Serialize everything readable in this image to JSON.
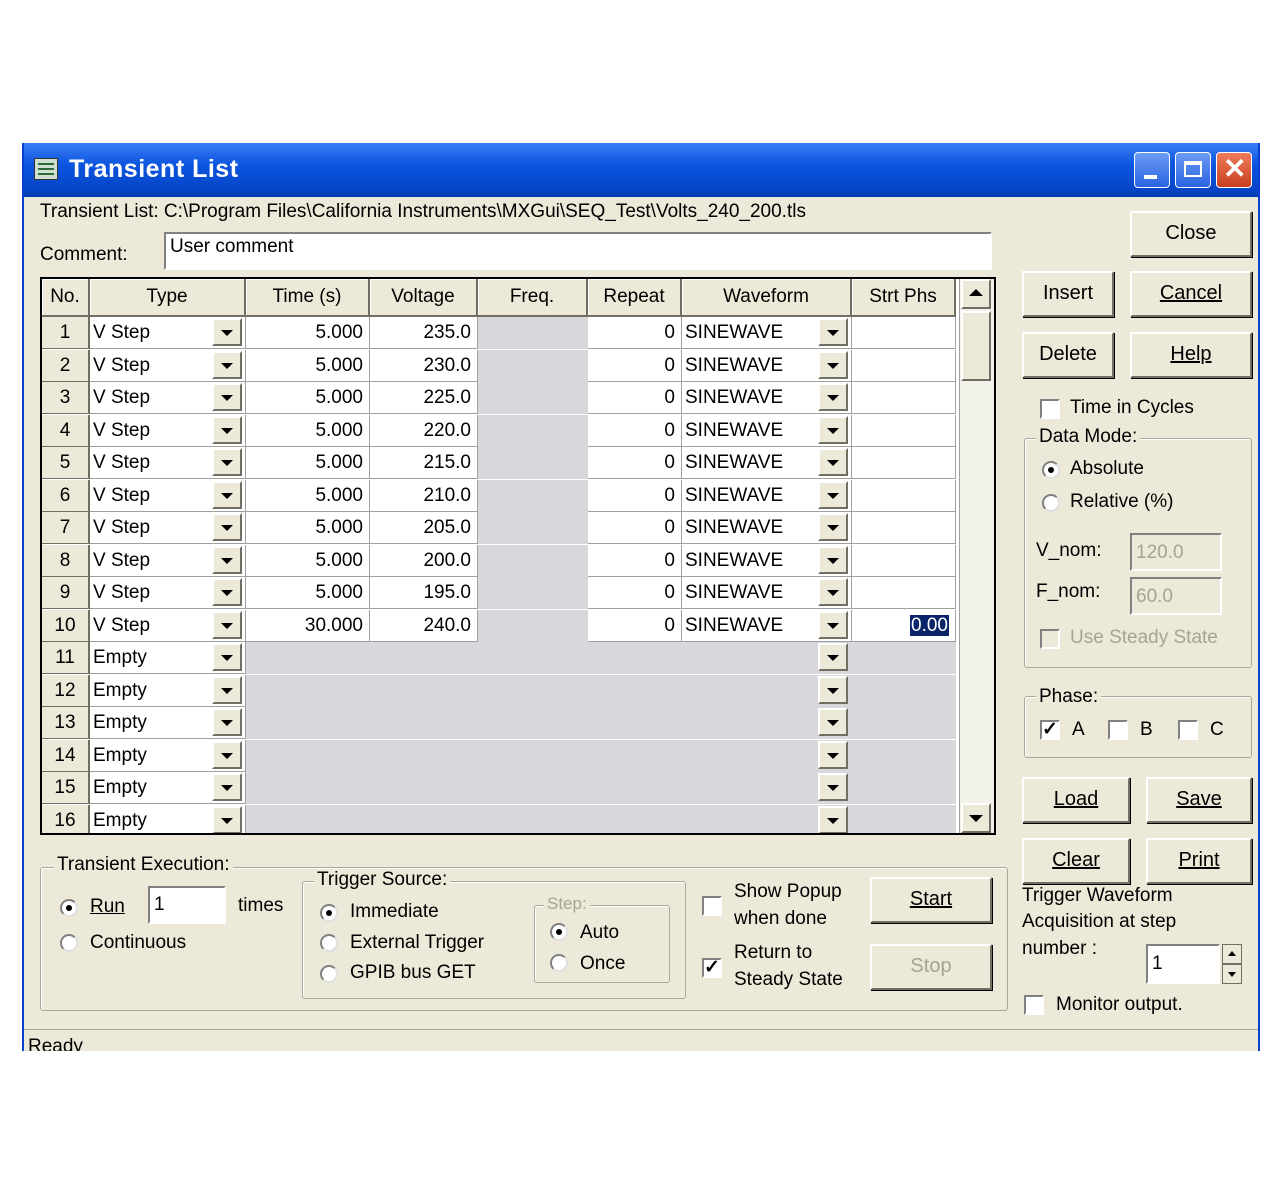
{
  "window": {
    "title": "Transient List"
  },
  "file": {
    "label": "Transient List:",
    "path": "C:\\Program Files\\California Instruments\\MXGui\\SEQ_Test\\Volts_240_200.tls"
  },
  "comment": {
    "label": "Comment:",
    "value": "User comment"
  },
  "grid": {
    "headers": [
      "No.",
      "Type",
      "Time (s)",
      "Voltage",
      "Freq.",
      "Repeat",
      "Waveform",
      "Strt Phs"
    ],
    "rows": [
      {
        "no": "1",
        "type": "V Step",
        "time": "5.000",
        "voltage": "235.0",
        "freq": "",
        "repeat": "0",
        "waveform": "SINEWAVE",
        "phase": ""
      },
      {
        "no": "2",
        "type": "V Step",
        "time": "5.000",
        "voltage": "230.0",
        "freq": "",
        "repeat": "0",
        "waveform": "SINEWAVE",
        "phase": ""
      },
      {
        "no": "3",
        "type": "V Step",
        "time": "5.000",
        "voltage": "225.0",
        "freq": "",
        "repeat": "0",
        "waveform": "SINEWAVE",
        "phase": ""
      },
      {
        "no": "4",
        "type": "V Step",
        "time": "5.000",
        "voltage": "220.0",
        "freq": "",
        "repeat": "0",
        "waveform": "SINEWAVE",
        "phase": ""
      },
      {
        "no": "5",
        "type": "V Step",
        "time": "5.000",
        "voltage": "215.0",
        "freq": "",
        "repeat": "0",
        "waveform": "SINEWAVE",
        "phase": ""
      },
      {
        "no": "6",
        "type": "V Step",
        "time": "5.000",
        "voltage": "210.0",
        "freq": "",
        "repeat": "0",
        "waveform": "SINEWAVE",
        "phase": ""
      },
      {
        "no": "7",
        "type": "V Step",
        "time": "5.000",
        "voltage": "205.0",
        "freq": "",
        "repeat": "0",
        "waveform": "SINEWAVE",
        "phase": ""
      },
      {
        "no": "8",
        "type": "V Step",
        "time": "5.000",
        "voltage": "200.0",
        "freq": "",
        "repeat": "0",
        "waveform": "SINEWAVE",
        "phase": ""
      },
      {
        "no": "9",
        "type": "V Step",
        "time": "5.000",
        "voltage": "195.0",
        "freq": "",
        "repeat": "0",
        "waveform": "SINEWAVE",
        "phase": ""
      },
      {
        "no": "10",
        "type": "V Step",
        "time": "30.000",
        "voltage": "240.0",
        "freq": "",
        "repeat": "0",
        "waveform": "SINEWAVE",
        "phase": "0.00"
      },
      {
        "no": "11",
        "type": "Empty",
        "time": "",
        "voltage": "",
        "freq": "",
        "repeat": "",
        "waveform": "",
        "phase": ""
      },
      {
        "no": "12",
        "type": "Empty",
        "time": "",
        "voltage": "",
        "freq": "",
        "repeat": "",
        "waveform": "",
        "phase": ""
      },
      {
        "no": "13",
        "type": "Empty",
        "time": "",
        "voltage": "",
        "freq": "",
        "repeat": "",
        "waveform": "",
        "phase": ""
      },
      {
        "no": "14",
        "type": "Empty",
        "time": "",
        "voltage": "",
        "freq": "",
        "repeat": "",
        "waveform": "",
        "phase": ""
      },
      {
        "no": "15",
        "type": "Empty",
        "time": "",
        "voltage": "",
        "freq": "",
        "repeat": "",
        "waveform": "",
        "phase": ""
      },
      {
        "no": "16",
        "type": "Empty",
        "time": "",
        "voltage": "",
        "freq": "",
        "repeat": "",
        "waveform": "",
        "phase": ""
      }
    ]
  },
  "buttons": {
    "close": "Close",
    "insert": "Insert",
    "cancel": "Cancel",
    "delete": "Delete",
    "help": "Help",
    "load": "Load",
    "save": "Save",
    "clear": "Clear",
    "print": "Print",
    "start": "Start",
    "stop": "Stop"
  },
  "options": {
    "time_in_cycles": {
      "label": "Time in Cycles",
      "checked": false
    },
    "data_mode": {
      "title": "Data Mode:",
      "absolute": "Absolute",
      "relative": "Relative (%)",
      "selected": "Absolute",
      "v_nom_label": "V_nom:",
      "v_nom_value": "120.0",
      "f_nom_label": "F_nom:",
      "f_nom_value": "60.0",
      "use_steady_state": "Use Steady State"
    },
    "phase": {
      "title": "Phase:",
      "a": "A",
      "b": "B",
      "c": "C",
      "a_checked": true,
      "b_checked": false,
      "c_checked": false
    },
    "trigger_waveform": {
      "line1": "Trigger Waveform",
      "line2": "Acquisition at step",
      "line3": "number :",
      "value": "1"
    },
    "monitor_output": "Monitor output."
  },
  "execution": {
    "title": "Transient Execution:",
    "run": "Run",
    "run_count": "1",
    "times": "times",
    "continuous": "Continuous",
    "selected": "Run"
  },
  "trigger_source": {
    "title": "Trigger Source:",
    "immediate": "Immediate",
    "external": "External Trigger",
    "gpib": "GPIB bus GET",
    "selected": "Immediate",
    "step": {
      "title": "Step:",
      "auto": "Auto",
      "once": "Once",
      "selected": "Auto"
    }
  },
  "completion": {
    "show_popup_line1": "Show Popup",
    "show_popup_line2": "when done",
    "show_popup_checked": false,
    "return_line1": "Return to",
    "return_line2": "Steady State",
    "return_checked": true
  },
  "status": {
    "text": "Ready"
  },
  "colors": {
    "titlebar": "#0b55df",
    "window_bg": "#ece9d8",
    "grid_disabled": "#d8d8dc",
    "selection": "#0a246a"
  }
}
